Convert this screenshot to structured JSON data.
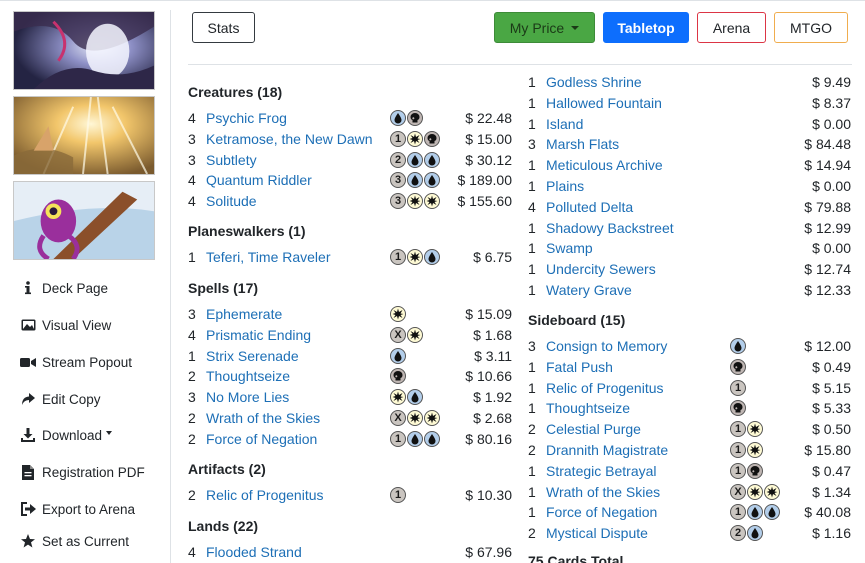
{
  "sidebar": {
    "items": [
      {
        "label": "Deck Page",
        "icon": "info-icon"
      },
      {
        "label": "Visual View",
        "icon": "image-icon"
      },
      {
        "label": "Stream Popout",
        "icon": "video-icon"
      },
      {
        "label": "Edit Copy",
        "icon": "share-arrow-icon"
      },
      {
        "label": "Download",
        "icon": "download-icon"
      },
      {
        "label": "Registration PDF",
        "icon": "file-pdf-icon"
      },
      {
        "label": "Export to Arena",
        "icon": "sign-in-icon"
      },
      {
        "label": "Set as Current",
        "icon": "star-icon"
      }
    ]
  },
  "toolbar": {
    "stats": "Stats",
    "my_price": "My Price",
    "tabletop": "Tabletop",
    "arena": "Arena",
    "mtgo": "MTGO"
  },
  "colors": {
    "link": "#1d6fb6",
    "my_price_bg": "#28a745",
    "tabletop_bg": "#0d6efd",
    "arena_border": "#dc3545",
    "mtgo_border": "#f0ad4e",
    "mana_blue": "#b3ceea",
    "mana_white": "#fffbd5",
    "mana_black": "#bfb6b3",
    "mana_colorless": "#cac5c0"
  },
  "left_column": {
    "sections": [
      {
        "title": "Creatures (18)",
        "cards": [
          {
            "qty": "4",
            "name": "Psychic Frog",
            "mana": [
              "U",
              "B"
            ],
            "price": "$ 22.48"
          },
          {
            "qty": "3",
            "name": "Ketramose, the New Dawn",
            "mana": [
              "1",
              "W",
              "B"
            ],
            "price": "$ 15.00"
          },
          {
            "qty": "3",
            "name": "Subtlety",
            "mana": [
              "2",
              "U",
              "U"
            ],
            "price": "$ 30.12"
          },
          {
            "qty": "4",
            "name": "Quantum Riddler",
            "mana": [
              "3",
              "U",
              "U"
            ],
            "price": "$ 189.00"
          },
          {
            "qty": "4",
            "name": "Solitude",
            "mana": [
              "3",
              "W",
              "W"
            ],
            "price": "$ 155.60"
          }
        ]
      },
      {
        "title": "Planeswalkers (1)",
        "cards": [
          {
            "qty": "1",
            "name": "Teferi, Time Raveler",
            "mana": [
              "1",
              "W",
              "U"
            ],
            "price": "$ 6.75"
          }
        ]
      },
      {
        "title": "Spells (17)",
        "cards": [
          {
            "qty": "3",
            "name": "Ephemerate",
            "mana": [
              "W"
            ],
            "price": "$ 15.09"
          },
          {
            "qty": "4",
            "name": "Prismatic Ending",
            "mana": [
              "X",
              "W"
            ],
            "price": "$ 1.68"
          },
          {
            "qty": "1",
            "name": "Strix Serenade",
            "mana": [
              "U"
            ],
            "price": "$ 3.11"
          },
          {
            "qty": "2",
            "name": "Thoughtseize",
            "mana": [
              "B"
            ],
            "price": "$ 10.66"
          },
          {
            "qty": "3",
            "name": "No More Lies",
            "mana": [
              "W",
              "U"
            ],
            "price": "$ 1.92"
          },
          {
            "qty": "2",
            "name": "Wrath of the Skies",
            "mana": [
              "X",
              "W",
              "W"
            ],
            "price": "$ 2.68"
          },
          {
            "qty": "2",
            "name": "Force of Negation",
            "mana": [
              "1",
              "U",
              "U"
            ],
            "price": "$ 80.16"
          }
        ]
      },
      {
        "title": "Artifacts (2)",
        "cards": [
          {
            "qty": "2",
            "name": "Relic of Progenitus",
            "mana": [
              "1"
            ],
            "price": "$ 10.30"
          }
        ]
      },
      {
        "title": "Lands (22)",
        "cards": [
          {
            "qty": "4",
            "name": "Flooded Strand",
            "mana": [],
            "price": "$ 67.96"
          }
        ]
      }
    ]
  },
  "right_column": {
    "lands_continued": [
      {
        "qty": "1",
        "name": "Godless Shrine",
        "price": "$ 9.49"
      },
      {
        "qty": "1",
        "name": "Hallowed Fountain",
        "price": "$ 8.37"
      },
      {
        "qty": "1",
        "name": "Island",
        "price": "$ 0.00"
      },
      {
        "qty": "3",
        "name": "Marsh Flats",
        "price": "$ 84.48"
      },
      {
        "qty": "1",
        "name": "Meticulous Archive",
        "price": "$ 14.94"
      },
      {
        "qty": "1",
        "name": "Plains",
        "price": "$ 0.00"
      },
      {
        "qty": "4",
        "name": "Polluted Delta",
        "price": "$ 79.88"
      },
      {
        "qty": "1",
        "name": "Shadowy Backstreet",
        "price": "$ 12.99"
      },
      {
        "qty": "1",
        "name": "Swamp",
        "price": "$ 0.00"
      },
      {
        "qty": "1",
        "name": "Undercity Sewers",
        "price": "$ 12.74"
      },
      {
        "qty": "1",
        "name": "Watery Grave",
        "price": "$ 12.33"
      }
    ],
    "sideboard": {
      "title": "Sideboard (15)",
      "cards": [
        {
          "qty": "3",
          "name": "Consign to Memory",
          "mana": [
            "U"
          ],
          "price": "$ 12.00"
        },
        {
          "qty": "1",
          "name": "Fatal Push",
          "mana": [
            "B"
          ],
          "price": "$ 0.49"
        },
        {
          "qty": "1",
          "name": "Relic of Progenitus",
          "mana": [
            "1"
          ],
          "price": "$ 5.15"
        },
        {
          "qty": "1",
          "name": "Thoughtseize",
          "mana": [
            "B"
          ],
          "price": "$ 5.33"
        },
        {
          "qty": "2",
          "name": "Celestial Purge",
          "mana": [
            "1",
            "W"
          ],
          "price": "$ 0.50"
        },
        {
          "qty": "2",
          "name": "Drannith Magistrate",
          "mana": [
            "1",
            "W"
          ],
          "price": "$ 15.80"
        },
        {
          "qty": "1",
          "name": "Strategic Betrayal",
          "mana": [
            "1",
            "B"
          ],
          "price": "$ 0.47"
        },
        {
          "qty": "1",
          "name": "Wrath of the Skies",
          "mana": [
            "X",
            "W",
            "W"
          ],
          "price": "$ 1.34"
        },
        {
          "qty": "1",
          "name": "Force of Negation",
          "mana": [
            "1",
            "U",
            "U"
          ],
          "price": "$ 40.08"
        },
        {
          "qty": "2",
          "name": "Mystical Dispute",
          "mana": [
            "2",
            "U"
          ],
          "price": "$ 1.16"
        }
      ]
    },
    "total_label": "75 Cards Total"
  }
}
